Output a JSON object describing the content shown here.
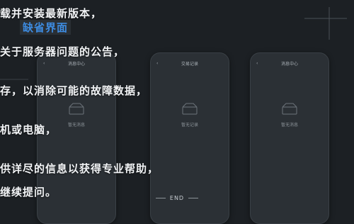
{
  "overlay": {
    "line_1": "载并安装最新版本，",
    "badge": "缺省界面",
    "line_3": "关于服务器问题的公告，",
    "line_4": "存，以消除可能的故障数据，",
    "line_5": "机或电脑，",
    "line_6": "供详尽的信息以获得专业帮助，",
    "line_7": "继续提问。",
    "end_label": "END"
  },
  "phones": [
    {
      "title": "消息中心",
      "empty_text": "暂无消息"
    },
    {
      "title": "交易记录",
      "empty_text": "暂无记录"
    },
    {
      "title": "消息中心",
      "empty_text": "暂无消息"
    }
  ],
  "colors": {
    "background": "#1c2024",
    "badge_text": "#3d8be0",
    "phone_body": "#2b3035"
  }
}
